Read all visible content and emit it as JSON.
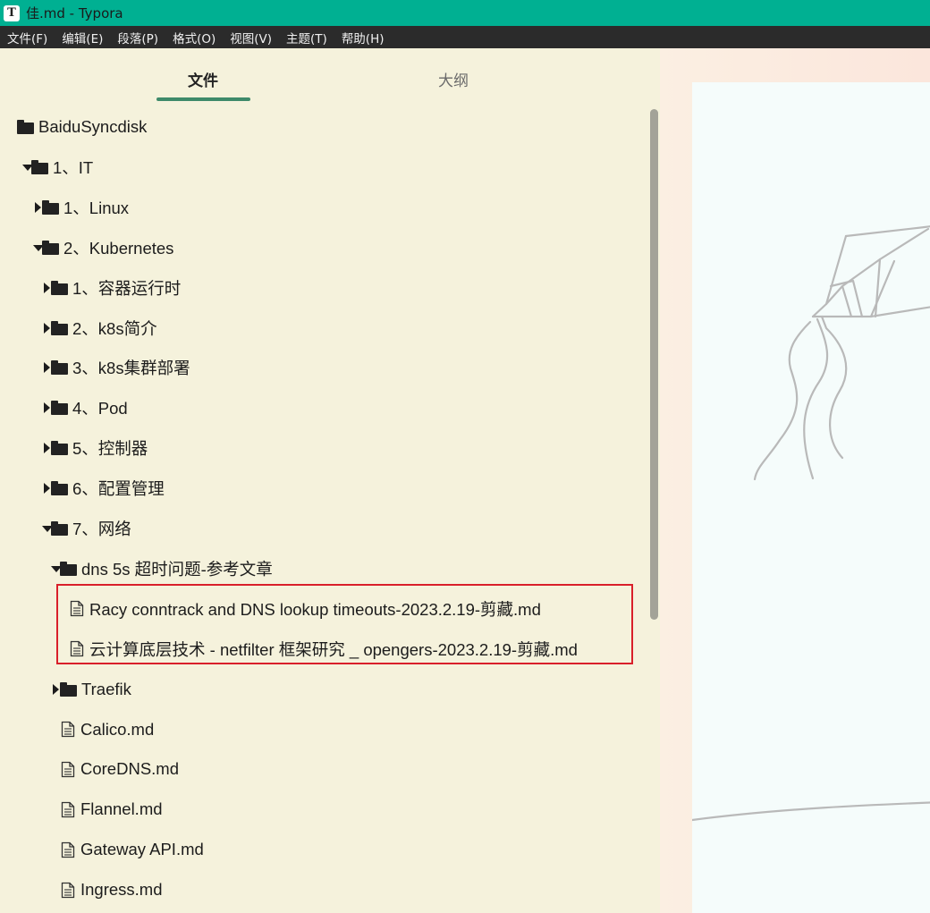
{
  "window": {
    "app_icon": "T",
    "title": "佳.md - Typora"
  },
  "menu": [
    "文件(F)",
    "编辑(E)",
    "段落(P)",
    "格式(O)",
    "视图(V)",
    "主题(T)",
    "帮助(H)"
  ],
  "sidebar": {
    "tabs": {
      "files": "文件",
      "outline": "大纲"
    },
    "tree": [
      {
        "label": "BaiduSyncdisk",
        "type": "folder",
        "arrow": "none",
        "depth": 0
      },
      {
        "label": "1、IT",
        "type": "folder",
        "arrow": "down",
        "depth": 1
      },
      {
        "label": "1、Linux",
        "type": "folder",
        "arrow": "right",
        "depth": 2
      },
      {
        "label": "2、Kubernetes",
        "type": "folder",
        "arrow": "down",
        "depth": 2
      },
      {
        "label": "1、容器运行时",
        "type": "folder",
        "arrow": "right",
        "depth": 3
      },
      {
        "label": "2、k8s简介",
        "type": "folder",
        "arrow": "right",
        "depth": 3
      },
      {
        "label": "3、k8s集群部署",
        "type": "folder",
        "arrow": "right",
        "depth": 3
      },
      {
        "label": "4、Pod",
        "type": "folder",
        "arrow": "right",
        "depth": 3
      },
      {
        "label": "5、控制器",
        "type": "folder",
        "arrow": "right",
        "depth": 3
      },
      {
        "label": "6、配置管理",
        "type": "folder",
        "arrow": "right",
        "depth": 3
      },
      {
        "label": "7、网络",
        "type": "folder",
        "arrow": "down",
        "depth": 3
      },
      {
        "label": "dns 5s 超时问题-参考文章",
        "type": "folder",
        "arrow": "down",
        "depth": 4
      },
      {
        "label": "Racy conntrack and DNS lookup timeouts-2023.2.19-剪藏.md",
        "type": "file",
        "arrow": "none",
        "depth": 5,
        "highlighted": true
      },
      {
        "label": "云计算底层技术 - netfilter 框架研究 _ opengers-2023.2.19-剪藏.md",
        "type": "file",
        "arrow": "none",
        "depth": 5,
        "highlighted": true
      },
      {
        "label": "Traefik",
        "type": "folder",
        "arrow": "right",
        "depth": 4
      },
      {
        "label": "Calico.md",
        "type": "file",
        "arrow": "none",
        "depth": 4
      },
      {
        "label": "CoreDNS.md",
        "type": "file",
        "arrow": "none",
        "depth": 4
      },
      {
        "label": "Flannel.md",
        "type": "file",
        "arrow": "none",
        "depth": 4
      },
      {
        "label": "Gateway API.md",
        "type": "file",
        "arrow": "none",
        "depth": 4
      },
      {
        "label": "Ingress.md",
        "type": "file",
        "arrow": "none",
        "depth": 4
      }
    ]
  },
  "colors": {
    "titlebar": "#00b092",
    "menubar": "#2b2b2b",
    "sidebar_bg": "#f5f2dc",
    "tab_underline": "#3e8a6a",
    "highlight_border": "#d9202a"
  }
}
